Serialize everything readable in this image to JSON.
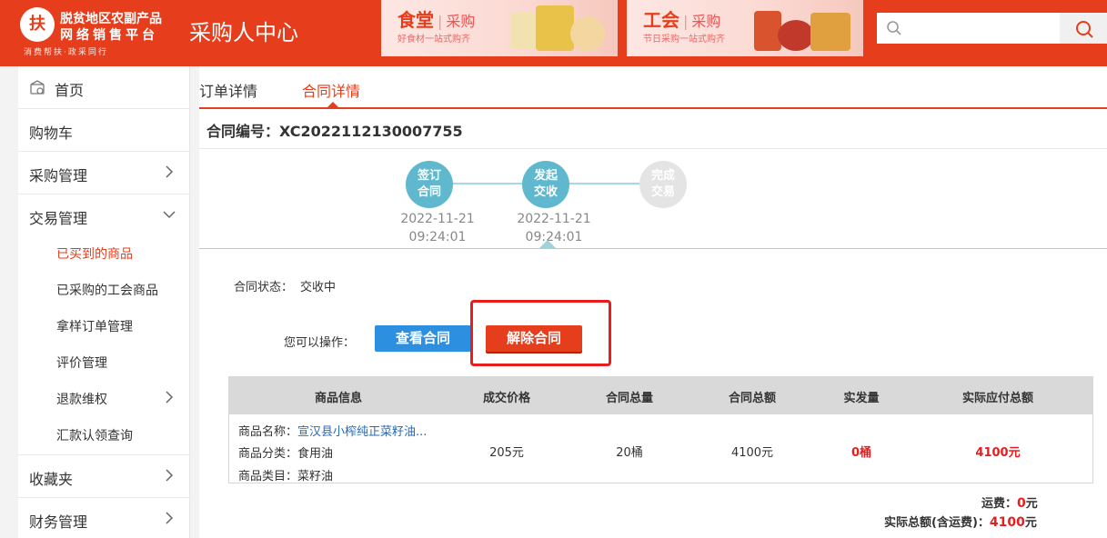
{
  "header": {
    "logo_emblem": "扶",
    "logo_line1": "脱贫地区农副产品",
    "logo_line2": "网络销售平台",
    "logo_line3": "消费帮扶·政采同行",
    "site_title": "采购人中心",
    "search_placeholder": "",
    "banners": [
      {
        "main": "食堂",
        "sub": "采购",
        "tag": "好食材一站式购齐"
      },
      {
        "main": "工会",
        "sub": "采购",
        "tag": "节日采购一站式购齐"
      }
    ]
  },
  "sidebar": {
    "items": [
      {
        "label": "首页"
      },
      {
        "label": "购物车"
      },
      {
        "label": "采购管理"
      },
      {
        "label": "交易管理"
      },
      {
        "label": "收藏夹"
      },
      {
        "label": "财务管理"
      }
    ],
    "sub_items": [
      {
        "label": "已买到的商品",
        "active": true
      },
      {
        "label": "已采购的工会商品"
      },
      {
        "label": "拿样订单管理"
      },
      {
        "label": "评价管理"
      },
      {
        "label": "退款维权"
      },
      {
        "label": "汇款认领查询"
      }
    ]
  },
  "tabs": [
    {
      "label": "订单详情",
      "active": false
    },
    {
      "label": "合同详情",
      "active": true
    }
  ],
  "contract": {
    "number_label": "合同编号：",
    "number": "XC2022112130007755"
  },
  "steps": [
    {
      "line1": "签订",
      "line2": "合同",
      "date": "2022-11-21",
      "time": "09:24:01",
      "done": true
    },
    {
      "line1": "发起",
      "line2": "交收",
      "date": "2022-11-21",
      "time": "09:24:01",
      "done": true
    },
    {
      "line1": "完成",
      "line2": "交易",
      "done": false
    }
  ],
  "status": {
    "label": "合同状态：",
    "value": "交收中"
  },
  "operations": {
    "label": "您可以操作：",
    "view_button": "查看合同",
    "cancel_button": "解除合同"
  },
  "table": {
    "headers": [
      "商品信息",
      "成交价格",
      "合同总量",
      "合同总额",
      "实发量",
      "实际应付总额"
    ],
    "row": {
      "name_label": "商品名称：",
      "name_value": "宣汉县小榨纯正菜籽油...",
      "category_label": "商品分类：",
      "category_value": "食用油",
      "type_label": "商品类目：",
      "type_value": "菜籽油",
      "price": "205元",
      "quantity": "20桶",
      "total": "4100元",
      "shipped": "0桶",
      "payable": "4100元"
    }
  },
  "fees": {
    "shipping_label": "运费：",
    "shipping_value": "0",
    "shipping_unit": "元",
    "total_label": "实际总额(含运费)：",
    "total_value": "4100",
    "total_unit": "元"
  },
  "colors": {
    "brand": "#e63e1c",
    "step_active": "#5fb8cd",
    "step_inactive": "#e4e4e4",
    "view_button": "#2d8fe0",
    "highlight": "#e81d1d"
  }
}
